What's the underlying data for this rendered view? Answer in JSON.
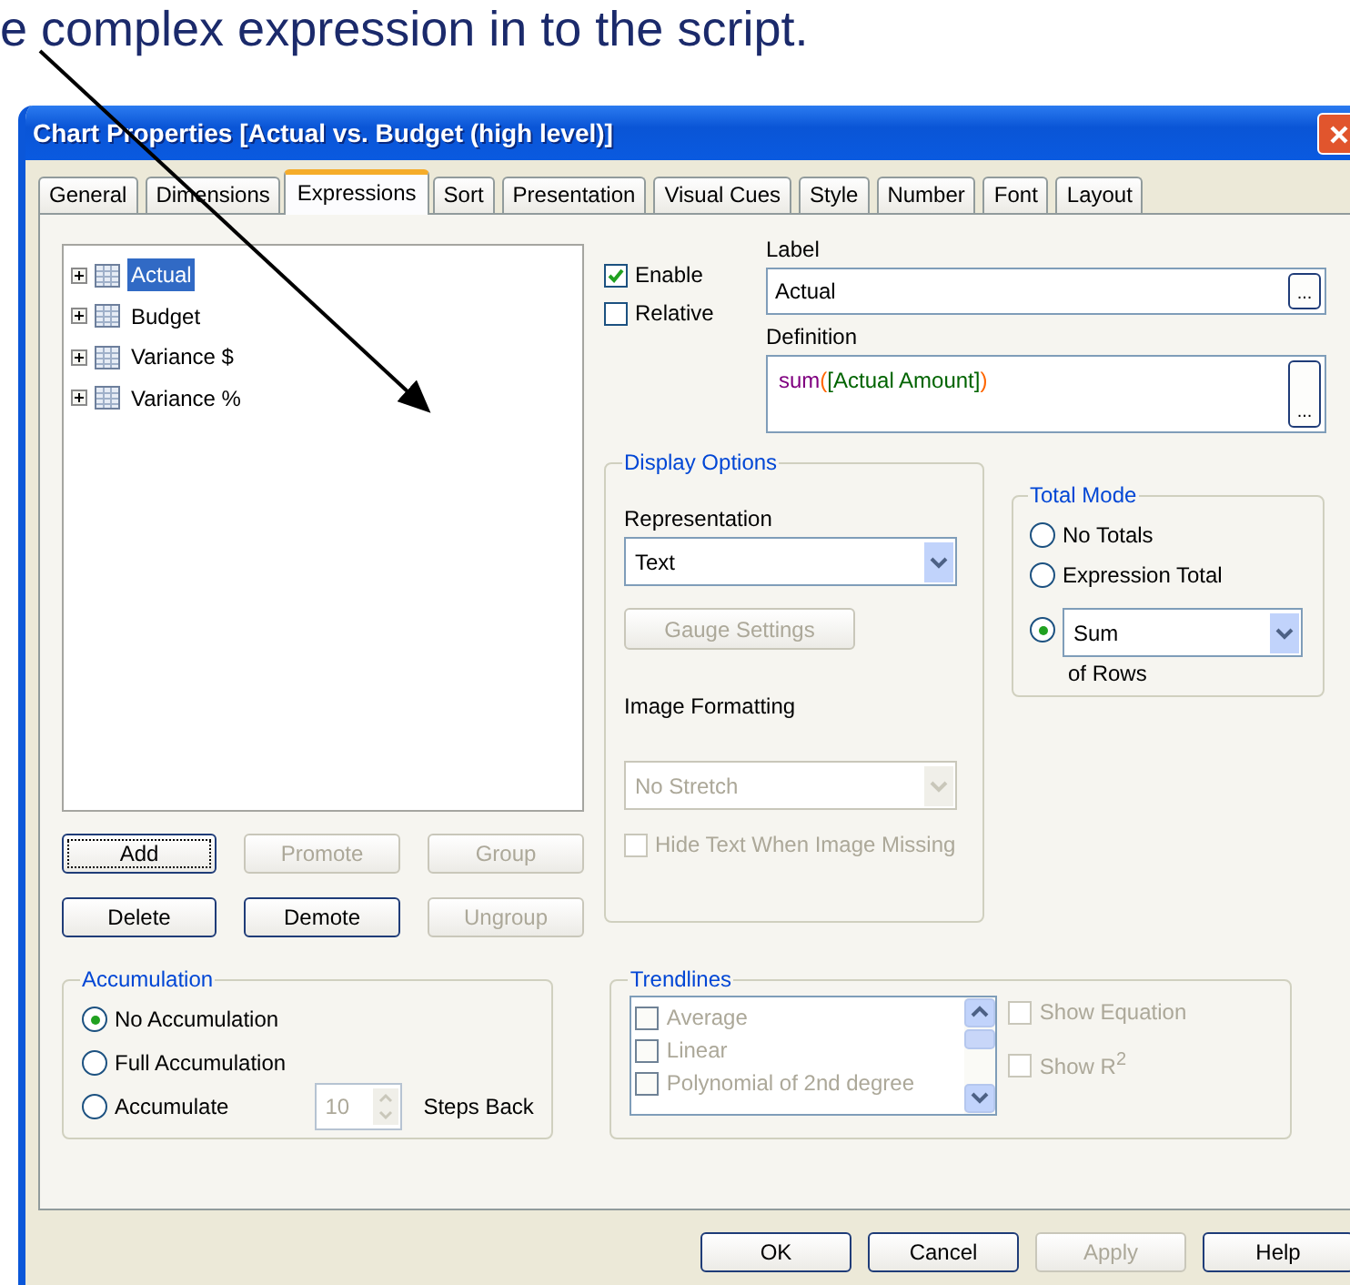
{
  "slide_caption": "e complex expression in to the script.",
  "window": {
    "title": "Chart Properties [Actual vs. Budget (high level)]"
  },
  "tabs": [
    {
      "label": "General",
      "selected": false
    },
    {
      "label": "Dimensions",
      "selected": false
    },
    {
      "label": "Expressions",
      "selected": true
    },
    {
      "label": "Sort",
      "selected": false
    },
    {
      "label": "Presentation",
      "selected": false
    },
    {
      "label": "Visual Cues",
      "selected": false
    },
    {
      "label": "Style",
      "selected": false
    },
    {
      "label": "Number",
      "selected": false
    },
    {
      "label": "Font",
      "selected": false
    },
    {
      "label": "Layout",
      "selected": false
    }
  ],
  "expressions": [
    {
      "label": "Actual",
      "expanded": false,
      "selected": true
    },
    {
      "label": "Budget",
      "expanded": false,
      "selected": false
    },
    {
      "label": "Variance $",
      "expanded": false,
      "selected": false
    },
    {
      "label": "Variance %",
      "expanded": false,
      "selected": false
    }
  ],
  "expression_buttons": [
    {
      "label": "Add",
      "disabled": false,
      "focused": true
    },
    {
      "label": "Promote",
      "disabled": true,
      "focused": false
    },
    {
      "label": "Group",
      "disabled": true,
      "focused": false
    },
    {
      "label": "Delete",
      "disabled": false,
      "focused": false
    },
    {
      "label": "Demote",
      "disabled": false,
      "focused": false
    },
    {
      "label": "Ungroup",
      "disabled": true,
      "focused": false
    }
  ],
  "flags": [
    {
      "label": "Enable",
      "checked": true
    },
    {
      "label": "Relative",
      "checked": false
    }
  ],
  "label_field": {
    "caption": "Label",
    "value": "Actual",
    "button": "..."
  },
  "definition_field": {
    "caption": "Definition",
    "button": "...",
    "tokens": [
      {
        "kind": "function",
        "text": "sum"
      },
      {
        "kind": "paren",
        "text": "("
      },
      {
        "kind": "field",
        "text": "[Actual Amount]"
      },
      {
        "kind": "paren",
        "text": ")"
      }
    ]
  },
  "display_options": {
    "title": "Display Options",
    "representation_label": "Representation",
    "representation": {
      "value": "Text",
      "disabled": false
    },
    "gauge_button": {
      "label": "Gauge Settings",
      "disabled": true
    },
    "image_formatting_label": "Image Formatting",
    "image_formatting": {
      "value": "No Stretch",
      "disabled": true
    },
    "hide_text": {
      "label": "Hide Text When Image Missing",
      "checked": false,
      "disabled": true
    }
  },
  "total_mode": {
    "title": "Total Mode",
    "suffix": "of Rows",
    "options": [
      {
        "kind": "label",
        "label": "No Totals",
        "selected": false
      },
      {
        "kind": "label",
        "label": "Expression Total",
        "selected": false
      },
      {
        "kind": "dropdown",
        "value": "Sum",
        "selected": true
      }
    ]
  },
  "accumulation": {
    "title": "Accumulation",
    "steps": {
      "value": "10",
      "disabled": true
    },
    "steps_label": "Steps Back",
    "options": [
      {
        "label": "No Accumulation",
        "selected": true
      },
      {
        "label": "Full Accumulation",
        "selected": false
      },
      {
        "label": "Accumulate",
        "selected": false
      }
    ]
  },
  "trendlines": {
    "title": "Trendlines",
    "items": [
      {
        "label": "Average",
        "checked": false,
        "disabled": true
      },
      {
        "label": "Linear",
        "checked": false,
        "disabled": true
      },
      {
        "label": "Polynomial of 2nd degree",
        "checked": false,
        "disabled": true
      }
    ],
    "options": [
      {
        "label": "Show Equation",
        "checked": false,
        "disabled": true
      },
      {
        "label": "Show R$^{2}$",
        "checked": false,
        "disabled": true
      }
    ]
  },
  "dialog_buttons": [
    {
      "label": "OK",
      "disabled": false
    },
    {
      "label": "Cancel",
      "disabled": false
    },
    {
      "label": "Apply",
      "disabled": true
    },
    {
      "label": "Help",
      "disabled": false
    }
  ]
}
